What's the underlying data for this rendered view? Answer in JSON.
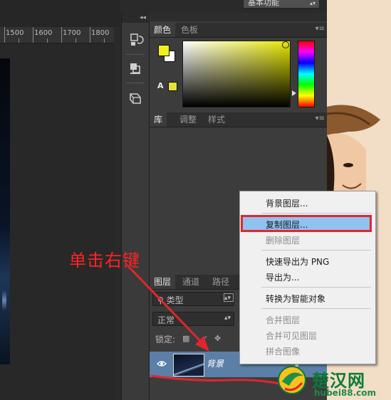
{
  "ruler": {
    "labels": [
      "1500",
      "1600",
      "1700",
      "1800"
    ]
  },
  "workspace": {
    "selected": "基本功能"
  },
  "color_panel": {
    "tabs": [
      "颜色",
      "色板"
    ],
    "foreground": "#f2f21a",
    "background": "#ffffff",
    "gamut_warning_label": "A"
  },
  "library_panel": {
    "tabs": [
      "库",
      "调整",
      "样式"
    ]
  },
  "layers_panel": {
    "tabs": [
      "图层",
      "通道",
      "路径"
    ],
    "filter_label": "类型",
    "blend_mode": "正常",
    "lock_label": "锁定:",
    "layer": {
      "name": "背景",
      "visible": true
    }
  },
  "context_menu": {
    "items": [
      {
        "label": "背景图层...",
        "enabled": true
      },
      {
        "label": "复制图层...",
        "enabled": true,
        "highlighted": true
      },
      {
        "label": "删除图层",
        "enabled": false
      },
      {
        "label": "快速导出为 PNG",
        "enabled": true
      },
      {
        "label": "导出为...",
        "enabled": true
      },
      {
        "label": "转换为智能对象",
        "enabled": true
      },
      {
        "label": "合并图层",
        "enabled": false
      },
      {
        "label": "合并可见图层",
        "enabled": false
      },
      {
        "label": "拼合图像",
        "enabled": false
      }
    ]
  },
  "annotation": {
    "text": "单击右键",
    "color": "#ff2323"
  },
  "watermark": {
    "brand": "楚汉网",
    "url": "hubei88.com"
  },
  "colors": {
    "accent_highlight": "#8fc2ef",
    "annotation_red": "#e2252c",
    "layer_selected": "#5b7fa6"
  }
}
